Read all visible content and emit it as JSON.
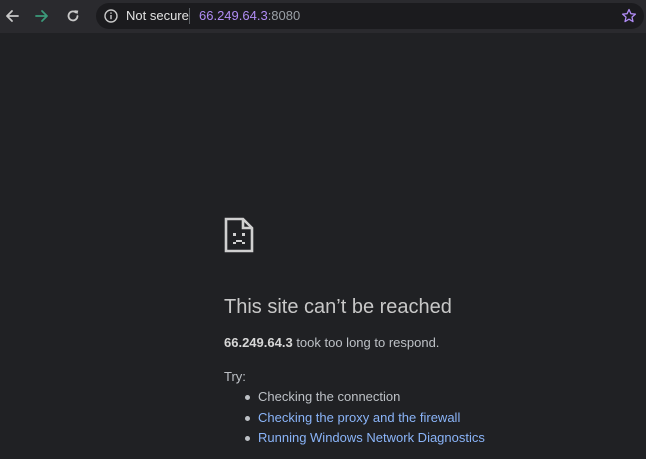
{
  "toolbar": {
    "back_icon": "arrow-left-icon",
    "forward_icon": "arrow-right-icon",
    "reload_icon": "reload-icon",
    "omnibox": {
      "security_icon": "info-circle-icon",
      "security_label": "Not secure",
      "url_host": "66.249.64.3",
      "url_port": ":8080",
      "bookmark_icon": "star-icon"
    },
    "colors": {
      "toolbar_bg": "#2a2a2e",
      "omnibox_bg": "#1b1b1e",
      "url_host": "#b08cf5",
      "forward_icon": "#3b9a7a"
    }
  },
  "error": {
    "icon": "sad-page-icon",
    "heading": "This site can’t be reached",
    "host": "66.249.64.3",
    "message": "took too long to respond.",
    "try_label": "Try:",
    "suggestions": [
      {
        "label": "Checking the connection",
        "link": false
      },
      {
        "label": "Checking the proxy and the firewall",
        "link": true
      },
      {
        "label": "Running Windows Network Diagnostics",
        "link": true
      }
    ],
    "colors": {
      "page_bg": "#202124",
      "text": "#bdc1c6",
      "link": "#8ab4f8"
    }
  }
}
